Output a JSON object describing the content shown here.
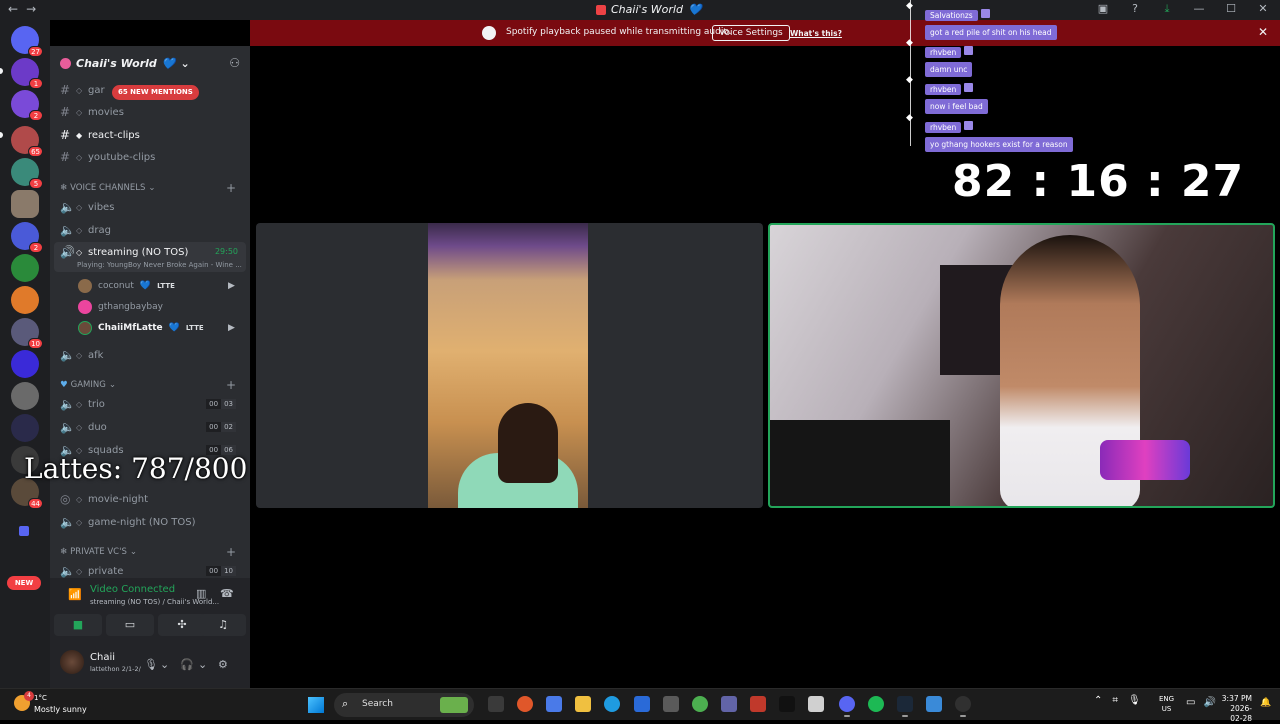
{
  "window": {
    "title": "Chaii's World",
    "title_heart": "💙"
  },
  "banner": {
    "text": "Spotify playback paused while transmitting audio.",
    "voice_settings": "Voice Settings",
    "whats_this": "What's this?"
  },
  "server": {
    "name": "Chaii's World",
    "heart": "💙"
  },
  "mentions_pill": "65 NEW MENTIONS",
  "channels_top": [
    {
      "name": "gar",
      "type": "text"
    },
    {
      "name": "movies",
      "type": "text"
    },
    {
      "name": "react-clips",
      "type": "text",
      "active": true
    },
    {
      "name": "youtube-clips",
      "type": "text"
    }
  ],
  "voice_category": "VOICE CHANNELS",
  "voice_channels": [
    {
      "name": "vibes"
    },
    {
      "name": "drag"
    }
  ],
  "streaming_channel": {
    "name": "streaming (NO TOS)",
    "time": "29:50",
    "sub": "Playing: YoungBoy Never Broke Again - Wine ..."
  },
  "voice_users": [
    {
      "name": "coconut",
      "tag": "LTTE",
      "heart": "💙"
    },
    {
      "name": "gthangbaybay",
      "tag": ""
    },
    {
      "name": "ChaiiMfLatte",
      "tag": "LTTE",
      "heart": "💙"
    }
  ],
  "afk_channel": "afk",
  "gaming_category": "GAMING",
  "gaming_channels": [
    {
      "name": "trio",
      "count_a": "00",
      "count_b": "03"
    },
    {
      "name": "duo",
      "count_a": "00",
      "count_b": "02"
    },
    {
      "name": "squads",
      "count_a": "00",
      "count_b": "06"
    }
  ],
  "event_channels": [
    {
      "name": "movie-night"
    },
    {
      "name": "game-night (NO TOS)"
    }
  ],
  "private_category": "PRIVATE VC'S",
  "private_channels": [
    {
      "name": "private",
      "count_a": "00",
      "count_b": "10"
    }
  ],
  "lattes_overlay": "Lattes: 787/800",
  "voice_panel": {
    "status": "Video Connected",
    "sub": "streaming (NO TOS) / Chaii's World..."
  },
  "user_panel": {
    "name": "Chaii",
    "status": "lattethon 2/1-2/"
  },
  "server_badges": [
    "27",
    "1",
    "2",
    "65",
    "5",
    "2",
    "10",
    "44"
  ],
  "rail_new": "NEW",
  "chat": [
    {
      "name": "Salvationzs",
      "text": "got a red pile of shit on his head"
    },
    {
      "name": "rhvben",
      "text": "damn unc"
    },
    {
      "name": "rhvben",
      "text": "now i feel bad"
    },
    {
      "name": "rhvben",
      "text": "yo gthang hookers exist for a reason"
    }
  ],
  "timer": "82 : 16 : 27",
  "taskbar": {
    "weather_badge": "4",
    "temperature": "1°C",
    "condition": "Mostly sunny",
    "search": "Search",
    "lang_top": "ENG",
    "lang_bottom": "US",
    "time": "3:37 PM",
    "date": "2026-02-28"
  },
  "colors": {
    "accent_green": "#23a55a",
    "banner_red": "#7a0a10",
    "chat_purple": "#7f6bd6",
    "mention_red": "#d83c3e"
  }
}
